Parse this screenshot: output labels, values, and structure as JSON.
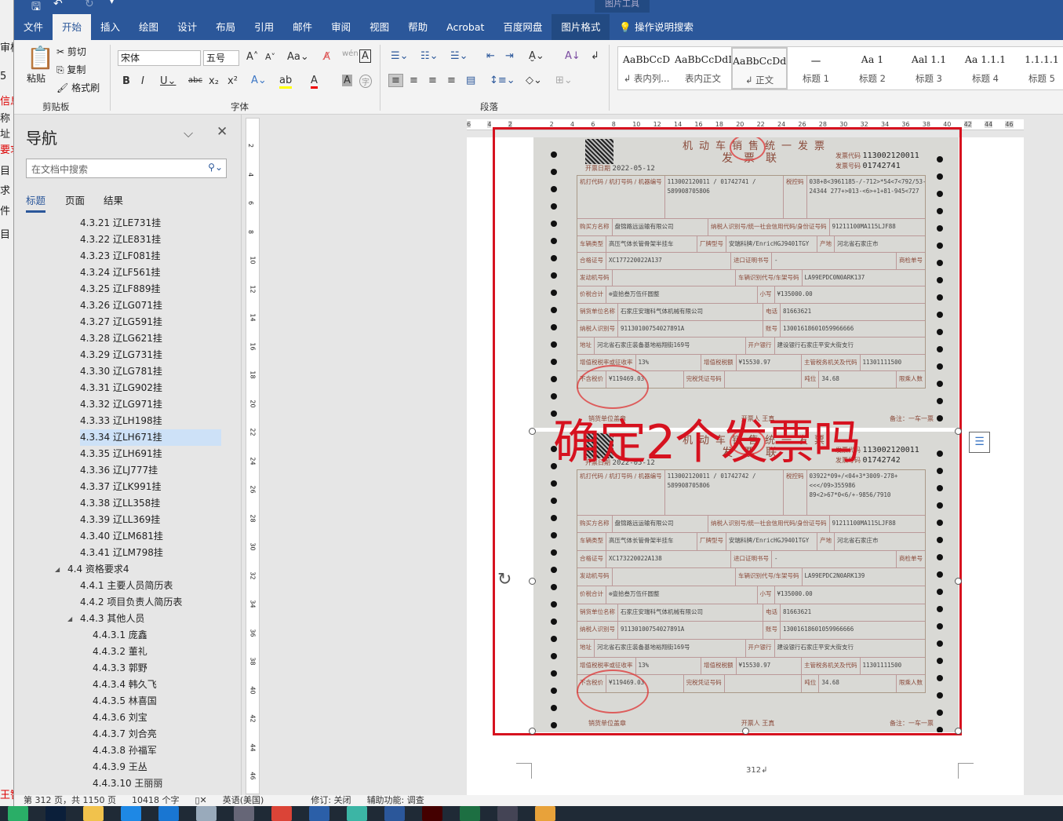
{
  "background_window": {
    "texts": [
      "审核",
      "5",
      "信息",
      "称",
      "址",
      "要求",
      "目",
      "求",
      "件",
      "目",
      "王智"
    ]
  },
  "qat": {
    "save": "save-icon",
    "undo": "undo-icon",
    "redo": "redo-icon"
  },
  "ribbon_tabs": [
    "文件",
    "开始",
    "插入",
    "绘图",
    "设计",
    "布局",
    "引用",
    "邮件",
    "审阅",
    "视图",
    "帮助",
    "Acrobat",
    "百度网盘",
    "图片格式"
  ],
  "context_label": "图片工具",
  "tell_me": "操作说明搜索",
  "clipboard": {
    "paste": "粘贴",
    "cut": "剪切",
    "copy": "复制",
    "format_painter": "格式刷",
    "label": "剪贴板"
  },
  "font": {
    "name": "宋体",
    "size": "五号",
    "label": "字体"
  },
  "paragraph": {
    "label": "段落"
  },
  "styles": [
    {
      "preview": "AaBbCcD",
      "name": "↲ 表内列..."
    },
    {
      "preview": "AaBbCcDdI",
      "name": "表内正文"
    },
    {
      "preview": "AaBbCcDdI",
      "name": "↲ 正文"
    },
    {
      "preview": "一",
      "name": "标题 1"
    },
    {
      "preview": "Aa 1",
      "name": "标题 2"
    },
    {
      "preview": "Aal 1.1",
      "name": "标题 3"
    },
    {
      "preview": "Aa 1.1.1",
      "name": "标题 4"
    },
    {
      "preview": "1.1.1.1",
      "name": "标题 5"
    }
  ],
  "nav": {
    "title": "导航",
    "search_placeholder": "在文档中搜索",
    "tabs": [
      "标题",
      "页面",
      "结果"
    ],
    "items": [
      {
        "text": "4.3.21 辽LE731挂",
        "level": 3
      },
      {
        "text": "4.3.22 辽LE831挂",
        "level": 3
      },
      {
        "text": "4.3.23 辽LF081挂",
        "level": 3
      },
      {
        "text": "4.3.24 辽LF561挂",
        "level": 3
      },
      {
        "text": "4.3.25 辽LF889挂",
        "level": 3
      },
      {
        "text": "4.3.26 辽LG071挂",
        "level": 3
      },
      {
        "text": "4.3.27 辽LG591挂",
        "level": 3
      },
      {
        "text": "4.3.28 辽LG621挂",
        "level": 3
      },
      {
        "text": "4.3.29 辽LG731挂",
        "level": 3
      },
      {
        "text": "4.3.30 辽LG781挂",
        "level": 3
      },
      {
        "text": "4.3.31 辽LG902挂",
        "level": 3
      },
      {
        "text": "4.3.32 辽LG971挂",
        "level": 3
      },
      {
        "text": "4.3.33 辽LH198挂",
        "level": 3
      },
      {
        "text": "4.3.34 辽LH671挂",
        "level": 3,
        "selected": true
      },
      {
        "text": "4.3.35 辽LH691挂",
        "level": 3
      },
      {
        "text": "4.3.36 辽LJ777挂",
        "level": 3
      },
      {
        "text": "4.3.37 辽LK991挂",
        "level": 3
      },
      {
        "text": "4.3.38 辽LL358挂",
        "level": 3
      },
      {
        "text": "4.3.39 辽LL369挂",
        "level": 3
      },
      {
        "text": "4.3.40 辽LM681挂",
        "level": 3
      },
      {
        "text": "4.3.41 辽LM798挂",
        "level": 3
      },
      {
        "text": "4.4 资格要求4",
        "level": 2,
        "expander": "◢"
      },
      {
        "text": "4.4.1 主要人员简历表",
        "level": 3
      },
      {
        "text": "4.4.2 项目负责人简历表",
        "level": 3
      },
      {
        "text": "4.4.3 其他人员",
        "level": 3,
        "expander": "◢"
      },
      {
        "text": "4.4.3.1 庞鑫",
        "level": 4
      },
      {
        "text": "4.4.3.2 董礼",
        "level": 4
      },
      {
        "text": "4.4.3.3 郭野",
        "level": 4
      },
      {
        "text": "4.4.3.4 韩久飞",
        "level": 4
      },
      {
        "text": "4.4.3.5 林喜国",
        "level": 4
      },
      {
        "text": "4.4.3.6 刘宝",
        "level": 4
      },
      {
        "text": "4.4.3.7 刘合亮",
        "level": 4
      },
      {
        "text": "4.4.3.8 孙福军",
        "level": 4
      },
      {
        "text": "4.4.3.9 王丛",
        "level": 4
      },
      {
        "text": "4.4.3.10 王丽丽",
        "level": 4
      }
    ]
  },
  "hruler_ticks": [
    "6",
    "4",
    "2",
    "",
    "2",
    "4",
    "6",
    "8",
    "10",
    "12",
    "14",
    "16",
    "18",
    "20",
    "22",
    "24",
    "26",
    "28",
    "30",
    "32",
    "34",
    "36",
    "38",
    "40",
    "42",
    "44",
    "46"
  ],
  "vruler_ticks": [
    "2",
    "4",
    "6",
    "8",
    "10",
    "12",
    "14",
    "16",
    "18",
    "20",
    "22",
    "24",
    "26",
    "28",
    "30",
    "32",
    "34",
    "36",
    "38",
    "40",
    "42",
    "44",
    "46"
  ],
  "overlay_text": "确定2个发票吗",
  "page_number": "312↲",
  "invoices": [
    {
      "title": "机动车销售统一发票",
      "copy": "发票联",
      "code_label": "发票代码",
      "code": "113002120011",
      "num_label": "发票号码",
      "number": "01742741",
      "date_label": "开票日期",
      "date": "2022-05-12",
      "rows": [
        [
          [
            "机打代码 / 机打号码 / 机器编号",
            ""
          ],
          [
            "113002120011 / 01742741 / 589908705806",
            "v"
          ],
          [
            "税控码",
            ""
          ],
          [
            "038+8<3961185-/-712>*54<7<792/53-24344 277+>013-<6>+1+81-945<727",
            "v"
          ]
        ],
        [
          [
            "购买方名称",
            ""
          ],
          [
            "盘锦路远运输有限公司",
            "v"
          ],
          [
            "纳税人识别号/统一社会信用代码/身份证号码",
            ""
          ],
          [
            "91211100MA115LJF88",
            "v"
          ]
        ],
        [
          [
            "车辆类型",
            ""
          ],
          [
            "高压气体长管骨架半挂车",
            "v"
          ],
          [
            "厂牌型号",
            ""
          ],
          [
            "安瑞科牌/EnricHGJ9401TGY",
            "v"
          ],
          [
            "产地",
            ""
          ],
          [
            "河北省石家庄市",
            "v"
          ]
        ],
        [
          [
            "合格证号",
            ""
          ],
          [
            "XC177220022A137",
            "v"
          ],
          [
            "进口证明书号",
            ""
          ],
          [
            "-",
            "v"
          ],
          [
            "商检单号",
            ""
          ]
        ],
        [
          [
            "发动机号码",
            ""
          ],
          [
            "",
            "v"
          ],
          [
            "车辆识别代号/车架号码",
            ""
          ],
          [
            "LA99EPDC0N0ARK137",
            "v"
          ]
        ],
        [
          [
            "价税合计",
            ""
          ],
          [
            "⊗壹拾叁万伍仟圆整",
            "v"
          ],
          [
            "小写",
            ""
          ],
          [
            "¥135000.00",
            "v"
          ]
        ],
        [
          [
            "销货单位名称",
            ""
          ],
          [
            "石家庄安瑞科气体机械有限公司",
            "v"
          ],
          [
            "电话",
            ""
          ],
          [
            "81663621",
            "v"
          ]
        ],
        [
          [
            "纳税人识别号",
            ""
          ],
          [
            "91130100754027891A",
            "v"
          ],
          [
            "账号",
            ""
          ],
          [
            "13001618601059966666",
            "v"
          ]
        ],
        [
          [
            "地址",
            ""
          ],
          [
            "河北省石家庄装备基地裕翔街169号",
            "v"
          ],
          [
            "开户银行",
            ""
          ],
          [
            "建设银行石家庄平安大街支行",
            "v"
          ]
        ],
        [
          [
            "增值税税率或征收率",
            ""
          ],
          [
            "13%",
            "v"
          ],
          [
            "增值税税额",
            ""
          ],
          [
            "¥15530.97",
            "v"
          ],
          [
            "主管税务机关及代码",
            ""
          ],
          [
            "11301111500",
            "v"
          ]
        ],
        [
          [
            "不含税价",
            ""
          ],
          [
            "¥119469.03",
            "v"
          ],
          [
            "完税凭证号码",
            ""
          ],
          [
            "",
            "v"
          ],
          [
            "吨位",
            ""
          ],
          [
            "34.68",
            "v"
          ],
          [
            "限乘人数",
            ""
          ]
        ]
      ],
      "footer": [
        "销货单位盖章",
        "开票人 王真",
        "备注：一车一票"
      ]
    },
    {
      "title": "机动车销售统一发票",
      "copy": "发票联",
      "code_label": "发票代码",
      "code": "113002120011",
      "num_label": "发票号码",
      "number": "01742742",
      "date_label": "开票日期",
      "date": "2022-05-12",
      "rows": [
        [
          [
            "机打代码 / 机打号码 / 机器编号",
            ""
          ],
          [
            "113002120011 / 01742742 / 589908705806",
            "v"
          ],
          [
            "税控码",
            ""
          ],
          [
            "03922*09+/<04+3*3009-278+<<</09>355986 89<2>67*0<6/+-9856/7910",
            "v"
          ]
        ],
        [
          [
            "购买方名称",
            ""
          ],
          [
            "盘锦路远运输有限公司",
            "v"
          ],
          [
            "纳税人识别号/统一社会信用代码/身份证号码",
            ""
          ],
          [
            "91211100MA115LJF88",
            "v"
          ]
        ],
        [
          [
            "车辆类型",
            ""
          ],
          [
            "高压气体长管骨架半挂车",
            "v"
          ],
          [
            "厂牌型号",
            ""
          ],
          [
            "安瑞科牌/EnricHGJ9401TGY",
            "v"
          ],
          [
            "产地",
            ""
          ],
          [
            "河北省石家庄市",
            "v"
          ]
        ],
        [
          [
            "合格证号",
            ""
          ],
          [
            "XC173220022A138",
            "v"
          ],
          [
            "进口证明书号",
            ""
          ],
          [
            "-",
            "v"
          ],
          [
            "商检单号",
            ""
          ]
        ],
        [
          [
            "发动机号码",
            ""
          ],
          [
            "",
            "v"
          ],
          [
            "车辆识别代号/车架号码",
            ""
          ],
          [
            "LA99EPDC2N0ARK139",
            "v"
          ]
        ],
        [
          [
            "价税合计",
            ""
          ],
          [
            "⊗壹拾叁万伍仟圆整",
            "v"
          ],
          [
            "小写",
            ""
          ],
          [
            "¥135000.00",
            "v"
          ]
        ],
        [
          [
            "销货单位名称",
            ""
          ],
          [
            "石家庄安瑞科气体机械有限公司",
            "v"
          ],
          [
            "电话",
            ""
          ],
          [
            "81663621",
            "v"
          ]
        ],
        [
          [
            "纳税人识别号",
            ""
          ],
          [
            "91130100754027891A",
            "v"
          ],
          [
            "账号",
            ""
          ],
          [
            "13001618601059966666",
            "v"
          ]
        ],
        [
          [
            "地址",
            ""
          ],
          [
            "河北省石家庄装备基地裕翔街169号",
            "v"
          ],
          [
            "开户银行",
            ""
          ],
          [
            "建设银行石家庄平安大街支行",
            "v"
          ]
        ],
        [
          [
            "增值税税率或征收率",
            ""
          ],
          [
            "13%",
            "v"
          ],
          [
            "增值税税额",
            ""
          ],
          [
            "¥15530.97",
            "v"
          ],
          [
            "主管税务机关及代码",
            ""
          ],
          [
            "11301111500",
            "v"
          ]
        ],
        [
          [
            "不含税价",
            ""
          ],
          [
            "¥119469.03",
            "v"
          ],
          [
            "完税凭证号码",
            ""
          ],
          [
            "",
            "v"
          ],
          [
            "吨位",
            ""
          ],
          [
            "34.68",
            "v"
          ],
          [
            "限乘人数",
            ""
          ]
        ]
      ],
      "footer": [
        "销货单位盖章",
        "开票人 王真",
        "备注：一车一票"
      ]
    }
  ],
  "status": {
    "page": "第 312 页，共 1150 页",
    "words": "10418 个字",
    "lang": "英语(美国)",
    "track": "修订: 关闭",
    "accessibility": "辅助功能: 调查"
  },
  "taskbar": {
    "apps": [
      "wechat",
      "photoshop",
      "file-explorer",
      "browser-1",
      "browser-2",
      "notepad",
      "calculator",
      "chrome",
      "network",
      "boss",
      "word",
      "adobe",
      "excel",
      "xmind",
      "other"
    ]
  },
  "colors": {
    "accent": "#2b579a",
    "selection": "#d6121f"
  }
}
